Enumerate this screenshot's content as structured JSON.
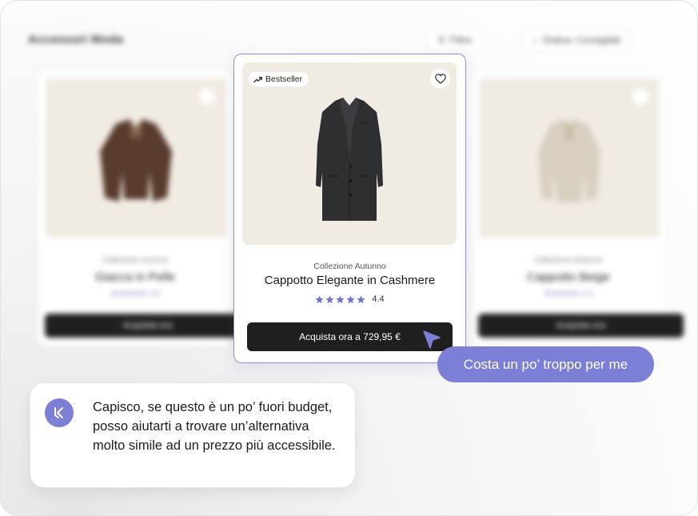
{
  "background": {
    "store_title": "Accessori Moda",
    "filter_button": "Filtra",
    "sort_button": "Ordina: Consigliati",
    "cards": [
      {
        "collection": "Collezione Inverno",
        "name": "Giacca in Pelle",
        "rating_text": "★★★★★ 4.6",
        "buy_label": "Acquista ora"
      },
      {
        "collection": "Collezione Autunno",
        "name": "Cappotto Beige",
        "rating_text": "★★★★★ 4.3",
        "buy_label": "Acquista ora"
      }
    ]
  },
  "product_card": {
    "badge_label": "Bestseller",
    "badge_icon": "trending-up-icon",
    "favorite_icon": "heart-icon",
    "collection": "Collezione Autunno",
    "name": "Cappotto Elegante in Cashmere",
    "rating": 4.4,
    "rating_text": "4.4",
    "buy_label": "Acquista ora a 729,95 €"
  },
  "chat": {
    "user_message": "Costa un po’ troppo per me",
    "assistant_message": "Capisco, se questo è un po’ fuori budget, posso aiutarti a trovare un’alternativa molto simile ad un prezzo più accessibile.",
    "assistant_icon": "assistant-logo-icon"
  },
  "colors": {
    "accent": "#7c7fd6",
    "card_border": "#8a8fe0",
    "button_dark": "#1f1f1f",
    "image_bg": "#f0ebe3",
    "star": "#6f73d2"
  }
}
